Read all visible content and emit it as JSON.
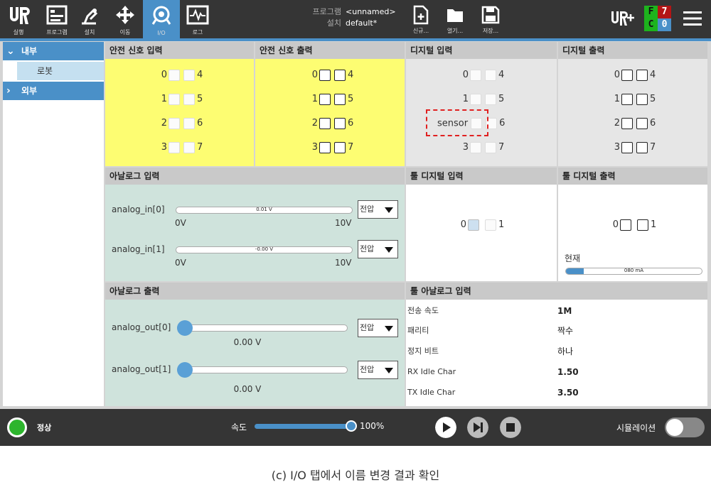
{
  "toolbar": {
    "run": "실행",
    "program": "프로그램",
    "installation": "설치",
    "move": "이동",
    "io": "I/O",
    "log": "로그"
  },
  "program_info": {
    "program_key": "프로그램",
    "program_val": "<unnamed>",
    "install_key": "설치",
    "install_val": "default*"
  },
  "file_buttons": {
    "new": "신규...",
    "open": "열기...",
    "save": "저장..."
  },
  "status_indicator": {
    "f": "F",
    "seven": "7",
    "c": "C",
    "zero": "0"
  },
  "sidebar": {
    "internal": "내부",
    "robot": "로봇",
    "external": "외부"
  },
  "panels": {
    "safety_in": {
      "title": "안전 신호 입력"
    },
    "safety_out": {
      "title": "안전 신호 출력"
    },
    "digital_in": {
      "title": "디지털 입력",
      "renamed": "sensor"
    },
    "digital_out": {
      "title": "디지털 출력"
    },
    "analog_in": {
      "title": "아날로그 입력",
      "ch0": {
        "label": "analog_in[0]",
        "value": "0.01 V",
        "fraction": 0.001,
        "mode": "전압",
        "min": "0V",
        "max": "10V"
      },
      "ch1": {
        "label": "analog_in[1]",
        "value": "-0.00 V",
        "fraction": 0.0,
        "mode": "전압",
        "min": "0V",
        "max": "10V"
      }
    },
    "tool_digital_in": {
      "title": "툴 디지털 입력"
    },
    "tool_digital_out": {
      "title": "툴 디지털 출력",
      "current_label": "현재",
      "current_value": "080 mA",
      "current_fraction": 0.13
    },
    "analog_out": {
      "title": "아날로그 출력",
      "ch0": {
        "label": "analog_out[0]",
        "value": "0.00 V",
        "fraction": 0.0,
        "mode": "전압"
      },
      "ch1": {
        "label": "analog_out[1]",
        "value": "0.00 V",
        "fraction": 0.0,
        "mode": "전압"
      }
    },
    "tool_analog_in": {
      "title": "툴 아날로그 입력",
      "rows": [
        {
          "k": "전송 속도",
          "v": "1M"
        },
        {
          "k": "패리티",
          "v": "짝수"
        },
        {
          "k": "정지 비트",
          "v": "하나"
        },
        {
          "k": "RX Idle Char",
          "v": "1.50"
        },
        {
          "k": "TX Idle Char",
          "v": "3.50"
        }
      ]
    }
  },
  "io_nums": {
    "n0": "0",
    "n1": "1",
    "n2": "2",
    "n3": "3",
    "n4": "4",
    "n5": "5",
    "n6": "6",
    "n7": "7"
  },
  "bottom": {
    "status": "정상",
    "speed_label": "속도",
    "speed_value": "100%",
    "speed_fraction": 1.0,
    "simulation": "시뮬레이션"
  },
  "caption": "(c) I/O 탭에서 이름 변경 결과 확인",
  "colors": {
    "accent": "#4a90c8",
    "safety": "#fdfd72",
    "analog": "#cfe3dc",
    "ok": "#2db52d",
    "f": "#1db31d",
    "seven": "#b31515",
    "c": "#1db31d",
    "zero": "#4a90c8"
  }
}
